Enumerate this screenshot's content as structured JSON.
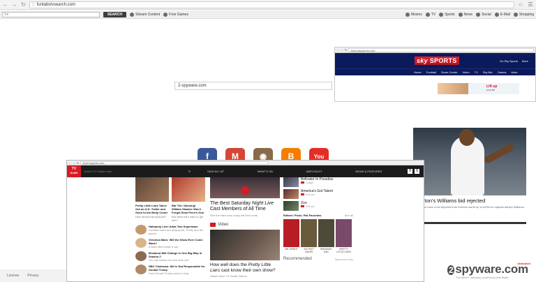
{
  "browser": {
    "url": "funtabstvsearch.com"
  },
  "toolbar": {
    "search_placeholder": "",
    "search_button": "SEARCH",
    "links": [
      {
        "label": "Stream Content",
        "icon": "globe-icon"
      },
      {
        "label": "Free Games",
        "icon": "gamepad-icon"
      },
      {
        "label": "Movies",
        "icon": "film-icon"
      },
      {
        "label": "TV",
        "icon": "tv-icon"
      },
      {
        "label": "Sports",
        "icon": "soccer-ball-icon"
      },
      {
        "label": "News",
        "icon": "news-icon"
      },
      {
        "label": "Social",
        "icon": "people-icon"
      },
      {
        "label": "E-Mail",
        "icon": "mail-icon"
      },
      {
        "label": "Shopping",
        "icon": "cart-icon"
      }
    ]
  },
  "center_search": {
    "value": "2-spyware.com"
  },
  "sky": {
    "url": "www.skysports.com",
    "logo": "sky",
    "logo_suffix": "SPORTS",
    "right": [
      "Go Sky Sports",
      "More"
    ],
    "nav": [
      "Home",
      "Football",
      "Score Centre",
      "Video",
      "TV",
      "Sky Bet",
      "Games",
      "More"
    ],
    "ad_text_1": "Lift up",
    "ad_text_2": "your life"
  },
  "news_photo": {
    "caption": "erton's Williams bid rejected",
    "subcaption": "erton have a bid rejected from Everton worth up to £28m for captain Ashley Williams."
  },
  "social_icons": [
    {
      "name": "facebook-icon",
      "glyph": "f",
      "color": "#3b5998"
    },
    {
      "name": "gmail-icon",
      "glyph": "M",
      "color": "#d44638"
    },
    {
      "name": "instagram-icon",
      "glyph": "◉",
      "color": "#8a6a4a"
    },
    {
      "name": "blogger-icon",
      "glyph": "B",
      "color": "#f57d00"
    },
    {
      "name": "youtube-icon",
      "glyph": "You",
      "color": "#e52d27"
    }
  ],
  "tvguide": {
    "url": "www.tvguide.com",
    "logo_top": "TV",
    "logo_bottom": "GUIDE",
    "search_placeholder": "Search TV Guide now!",
    "sign_in": "SIGN IN / UP",
    "nav": [
      "WHAT'S ON",
      "WATCHLIST",
      "NEWS & FEATURES"
    ],
    "col1_captions": [
      {
        "title": "Pretty Little Liars Takes Out an A.D. Trailer and Goes to the Body Count",
        "sub": "How about that episode?"
      },
      {
        "title": "Bar Teir: Dancing! William Shatner Won't Forget Sean Penn's Gun",
        "sub": "But what will it take to get him?"
      }
    ],
    "col1_stories": [
      {
        "title": "Hatepony Live! Adds Two Superstars",
        "sub": "Familiar faces are playing Mr. Pretty and the planet"
      },
      {
        "title": "Veronica Mars: Will the Show Ever Come Back?",
        "sub": "Kristen Bell thinks it can"
      },
      {
        "title": "Breakout Will Change in One Big Way in Season 2",
        "sub": "You can blame the new time slot"
      },
      {
        "title": "NBC Chairman: We're Not Responsible for Donald Trump",
        "sub": "How Donald Trump used to sing"
      }
    ],
    "hero_title_1": "The Best Saturday ",
    "hero_title_em": "Night Live",
    "hero_title_2": " Cast Members of All Time",
    "hero_sub": "See the stars who really left their mark",
    "video_label": "Video",
    "video_title_1": "How well does the ",
    "video_title_em": "Pretty Little Liars",
    "video_title_2": " cast know their own show?",
    "video_sub": "Watch More TV Guide Videos",
    "recs": [
      {
        "title": "Bellnator In Paradise",
        "sub": "Tonight"
      },
      {
        "title": "America's Got Talent",
        "sub": "8:00 pm"
      },
      {
        "title": "Zoo",
        "sub": "9:00 pm"
      }
    ],
    "picks_title": "Editors' Picks: Fall Favorites",
    "picks_more": "See all",
    "picks": [
      {
        "label": "MR. ROBOT",
        "color": "#b81c24"
      },
      {
        "label": "SIX FEET UNDER",
        "color": "#6a5a3c"
      },
      {
        "label": "BREAKING BAD",
        "color": "#4d4a3a"
      },
      {
        "label": "PRETTY LITTLE LIARS",
        "color": "#7a4a6a"
      }
    ],
    "recommended": "Recommended",
    "recommended_by": "Sponsored Links"
  },
  "footer": {
    "links": [
      "License",
      "Privacy"
    ]
  },
  "watermark": {
    "two": "2",
    "name": "spyware",
    "tld": ".com",
    "tag": "dedicated",
    "sub": "\"FunTabsTV\" extension, powered by Imali Media"
  }
}
